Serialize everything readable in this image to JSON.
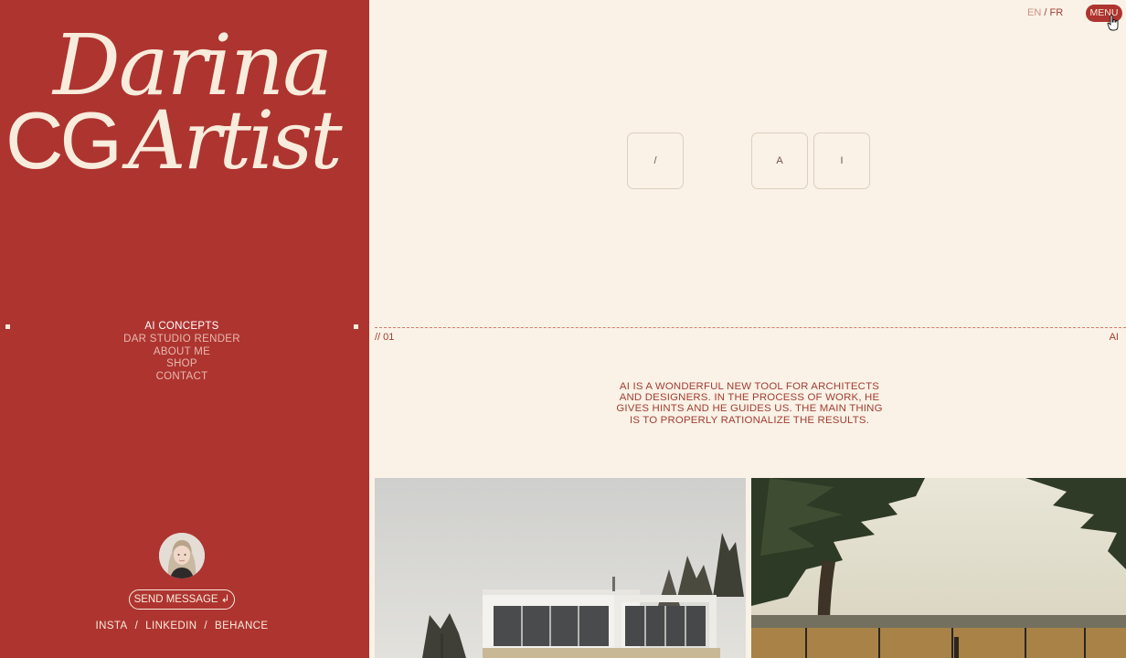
{
  "brand": {
    "line1": "Darina",
    "line2_a": "CG",
    "line2_b": "Artist"
  },
  "nav": {
    "items": [
      {
        "label": "AI CONCEPTS",
        "active": true
      },
      {
        "label": "DAR STUDIO RENDER",
        "active": false
      },
      {
        "label": "ABOUT ME",
        "active": false
      },
      {
        "label": "SHOP",
        "active": false
      },
      {
        "label": "CONTACT",
        "active": false
      }
    ]
  },
  "contact": {
    "send_label": "SEND MESSAGE ↲",
    "social": [
      "INSTA",
      "LINKEDIN",
      "BEHANCE"
    ],
    "separator": "/"
  },
  "header": {
    "lang_en": "EN",
    "lang_sep": "/",
    "lang_fr": "FR",
    "menu_label": "MENU"
  },
  "keys": [
    "/",
    "A",
    "I"
  ],
  "section": {
    "number": "// 01",
    "tag": "AI",
    "description": "AI IS A WONDERFUL NEW TOOL FOR ARCHITECTS AND DESIGNERS. IN THE PROCESS OF WORK, HE GIVES HINTS AND HE GUIDES US. THE MAIN THING IS TO PROPERLY RATIONALIZE THE RESULTS."
  },
  "colors": {
    "accent": "#ae3430",
    "cream": "#faf2e6",
    "text_accent": "#a33d33"
  }
}
